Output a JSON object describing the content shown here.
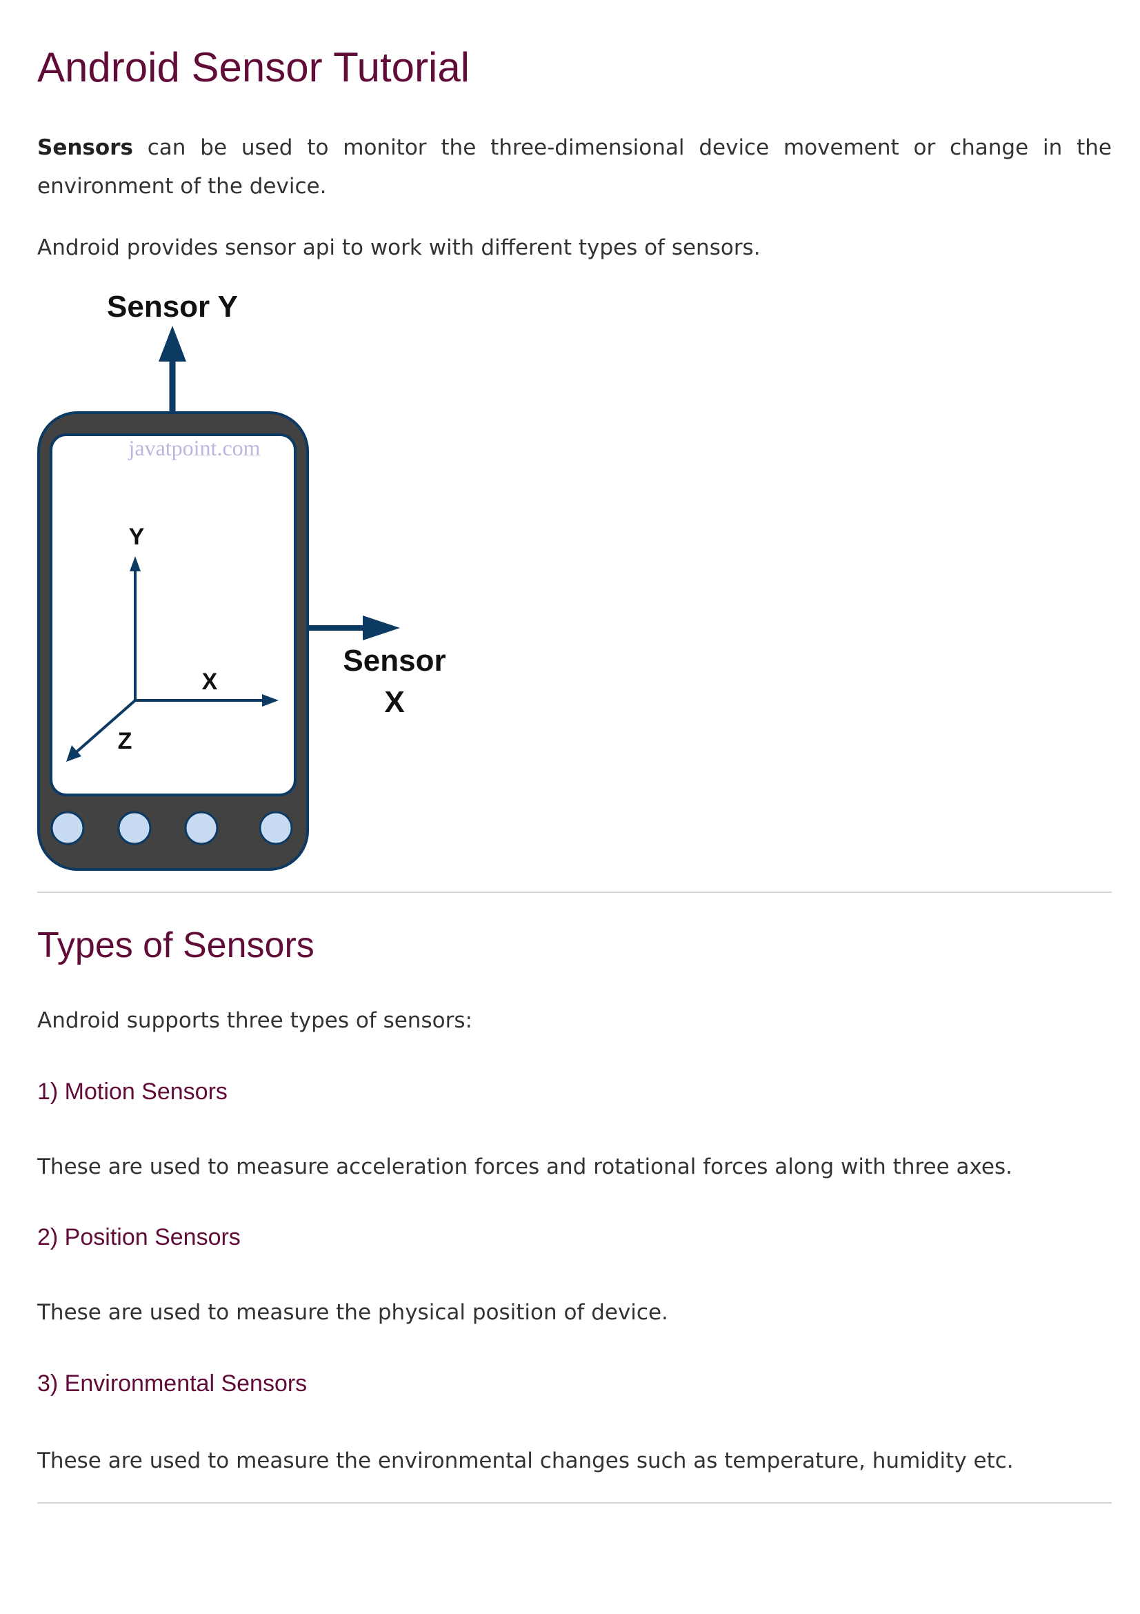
{
  "title": "Android Sensor Tutorial",
  "intro": {
    "bold": "Sensors",
    "rest": " can be used to monitor the three-dimensional device movement or change in the environment of the device."
  },
  "api_text": "Android provides sensor api to work with different types of sensors.",
  "diagram": {
    "sensor_y_label": "Sensor Y",
    "sensor_x_line1": "Sensor",
    "sensor_x_line2": "X",
    "watermark": "javatpoint.com",
    "axis_y": "Y",
    "axis_x": "X",
    "axis_z": "Z",
    "colors": {
      "body": "#424242",
      "screen": "#ffffff",
      "arrow": "#0d3a63",
      "button": "#c7dcf2",
      "watermark": "#b8b8e0"
    }
  },
  "types": {
    "heading": "Types of Sensors",
    "intro": "Android supports three types of sensors:",
    "items": [
      {
        "heading": "1) Motion Sensors",
        "text": "These are used to measure acceleration forces and rotational forces along with three axes."
      },
      {
        "heading": "2) Position Sensors",
        "text": "These are used to measure the physical position of device."
      },
      {
        "heading": "3) Environmental Sensors",
        "text": "These are used to measure the environmental changes such as temperature, humidity etc."
      }
    ]
  },
  "colors": {
    "heading": "#610b38",
    "text": "#333333",
    "divider": "#d5d5d5"
  }
}
